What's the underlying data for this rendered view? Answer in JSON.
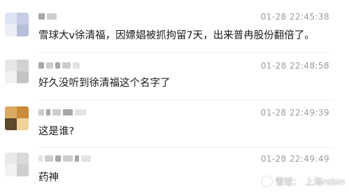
{
  "comments": [
    {
      "timestamp": "01-28 22:45:38",
      "text": "雪球大v徐清福，因嫖娼被抓拘留7天，出来普冉股份翻倍了。",
      "avatar_colors": [
        "#dfe4f2",
        "#c8cde6",
        "#eceff6",
        "#b6bed9"
      ]
    },
    {
      "timestamp": "01-28 22:48:58",
      "text": "好久没听到徐清福这个名字了",
      "avatar_colors": [
        "#e7e7e7",
        "#d2d2d2",
        "#f1f1f1",
        "#c4c4c4"
      ]
    },
    {
      "timestamp": "01-28 22:49:39",
      "text": "这是谁?",
      "avatar_colors": [
        "#d9ab62",
        "#c98a3a",
        "#5c4a2b",
        "#efd39a"
      ]
    },
    {
      "timestamp": "01-28 22:49:49",
      "text": "药神",
      "avatar_colors": [
        "#e9e9e9",
        "#d9d9d9",
        "#f2f2f2",
        "#cfcfcf"
      ]
    }
  ],
  "watermark": {
    "brand": "雪球：",
    "user": "上海robin",
    "icon": "snowball-logo-icon"
  }
}
